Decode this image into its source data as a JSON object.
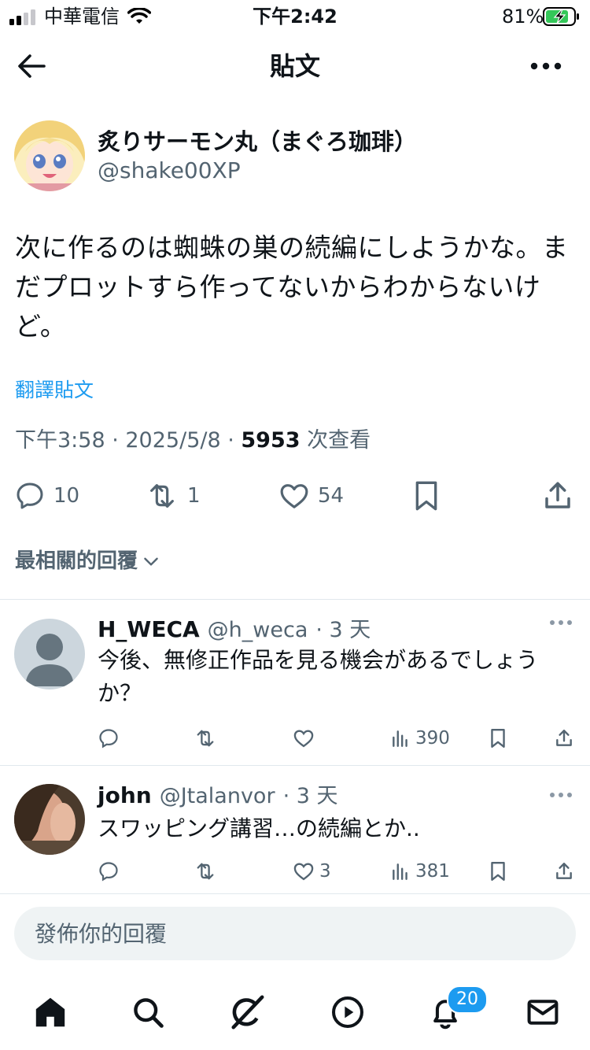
{
  "status_bar": {
    "carrier": "中華電信",
    "time": "下午2:42",
    "battery": "81%"
  },
  "header": {
    "title": "貼文",
    "back_icon": "back-arrow-icon",
    "more_icon": "more-horizontal-icon"
  },
  "post": {
    "author_name": "炙りサーモン丸（まぐろ珈琲）",
    "author_handle": "@shake00XP",
    "body": "次に作るのは蜘蛛の巣の続編にしようかな。まだプロットすら作ってないからわからないけど。",
    "translate_label": "翻譯貼文",
    "timestamp": "下午3:58 · 2025/5/8 · ",
    "views_count": "5953",
    "views_label": " 次查看",
    "actions": {
      "reply_count": "10",
      "repost_count": "1",
      "like_count": "54"
    }
  },
  "replies_sort_label": "最相關的回覆",
  "replies": [
    {
      "name": "H_WECA",
      "handle": "@h_weca",
      "age": "· 3 天",
      "text": "今後、無修正作品を見る機会があるでしょうか？",
      "like_count": "",
      "views": "390"
    },
    {
      "name": "john",
      "handle": "@Jtalanvor",
      "age": "· 3 天",
      "text": "スワッピング講習…の続編とか..",
      "like_count": "3",
      "views": "381"
    }
  ],
  "compose": {
    "placeholder": "發佈你的回覆"
  },
  "bottom_nav": {
    "notifications_badge": "20"
  },
  "colors": {
    "accent": "#1d9bf0",
    "text_primary": "#0f1419",
    "text_secondary": "#536471",
    "divider": "#e1e8ed",
    "battery_green": "#34c759"
  }
}
